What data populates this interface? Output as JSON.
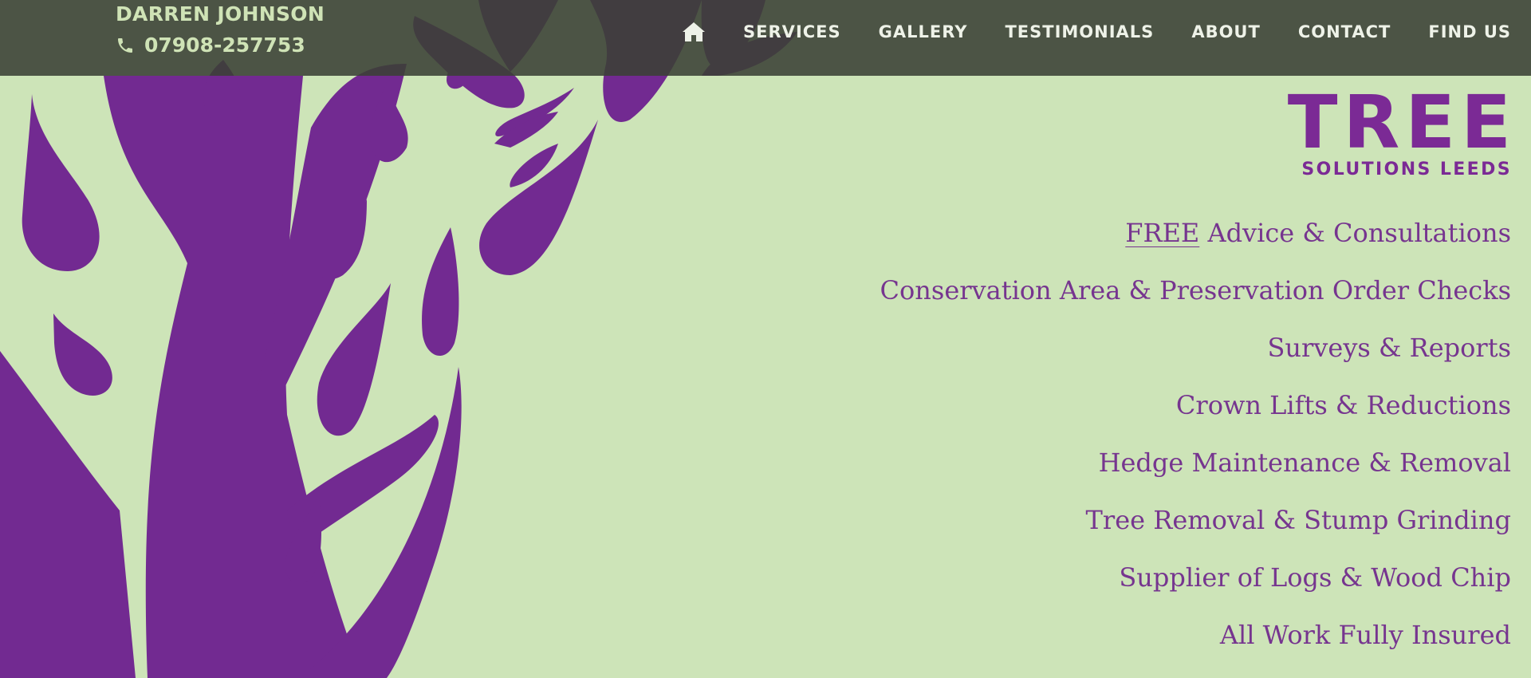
{
  "header": {
    "name": "DARREN JOHNSON",
    "phone": "07908-257753",
    "nav": [
      {
        "label": "SERVICES"
      },
      {
        "label": "GALLERY"
      },
      {
        "label": "TESTIMONIALS"
      },
      {
        "label": "ABOUT"
      },
      {
        "label": "CONTACT"
      },
      {
        "label": "FIND US"
      }
    ]
  },
  "logo": {
    "main": "TREE",
    "sub": "SOLUTIONS LEEDS"
  },
  "services": {
    "first_highlight": "FREE",
    "first_rest": " Advice & Consultations",
    "items": [
      "Conservation Area & Preservation Order Checks",
      "Surveys & Reports",
      "Crown Lifts & Reductions",
      "Hedge Maintenance & Removal",
      "Tree Removal & Stump Grinding",
      "Supplier of Logs & Wood Chip",
      "All Work Fully Insured"
    ]
  },
  "colors": {
    "background": "#cde4b8",
    "purple": "#76358f",
    "header": "#3a4034",
    "header_text": "#cfe3b6"
  },
  "icons": [
    "home-icon",
    "phone-icon"
  ]
}
